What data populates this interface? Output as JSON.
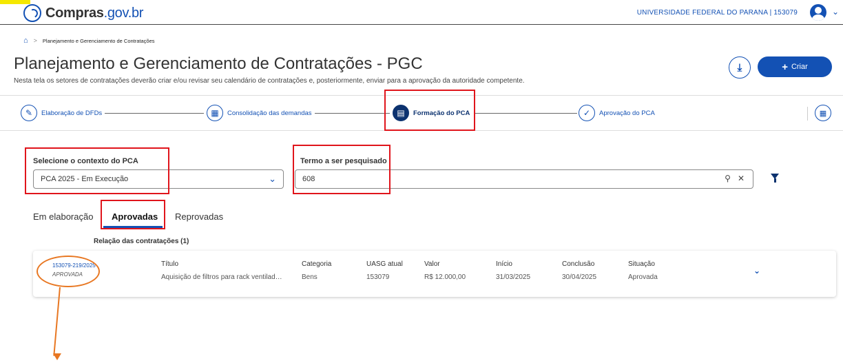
{
  "header": {
    "brand_name": "Compras",
    "brand_domain": ".gov.br",
    "user_org": "UNIVERSIDADE FEDERAL DO PARANA | 153079"
  },
  "breadcrumb": {
    "current": "Planejamento e Gerenciamento de Contratações"
  },
  "page": {
    "title": "Planejamento e Gerenciamento de Contratações - PGC",
    "subtitle": "Nesta tela os setores de contratações deverão criar e/ou revisar seu calendário de contratações e, posteriormente, enviar para a aprovação da autoridade competente.",
    "create_label": "Criar"
  },
  "stepper": {
    "steps": [
      {
        "label": "Elaboração de DFDs",
        "icon": "pen-icon",
        "active": false
      },
      {
        "label": "Consolidação das demandas",
        "icon": "clipboard-icon",
        "active": false
      },
      {
        "label": "Formação do PCA",
        "icon": "document-icon",
        "active": true
      },
      {
        "label": "Aprovação do PCA",
        "icon": "check-clipboard-icon",
        "active": false
      }
    ]
  },
  "filters": {
    "context_label": "Selecione o contexto do PCA",
    "context_value": "PCA 2025 - Em Execução",
    "search_label": "Termo a ser pesquisado",
    "search_value": "608"
  },
  "tabs": [
    {
      "label": "Em elaboração",
      "active": false
    },
    {
      "label": "Aprovadas",
      "active": true
    },
    {
      "label": "Reprovadas",
      "active": false
    }
  ],
  "list": {
    "heading": "Relação das contratações (1)",
    "columns": {
      "titulo": "Título",
      "categoria": "Categoria",
      "uasg": "UASG atual",
      "valor": "Valor",
      "inicio": "Início",
      "conclusao": "Conclusão",
      "situacao": "Situação"
    },
    "items": [
      {
        "id": "153079-219/2025",
        "status_badge": "APROVADA",
        "titulo": "Aquisição de filtros para rack ventilada ...",
        "categoria": "Bens",
        "uasg": "153079",
        "valor": "R$ 12.000,00",
        "inicio": "31/03/2025",
        "conclusao": "30/04/2025",
        "situacao": "Aprovada"
      }
    ]
  },
  "colors": {
    "primary": "#1351b4",
    "dark_primary": "#0c326f",
    "highlight_box": "#e0141b",
    "annotation": "#e87722",
    "tag": "#f5e800"
  }
}
